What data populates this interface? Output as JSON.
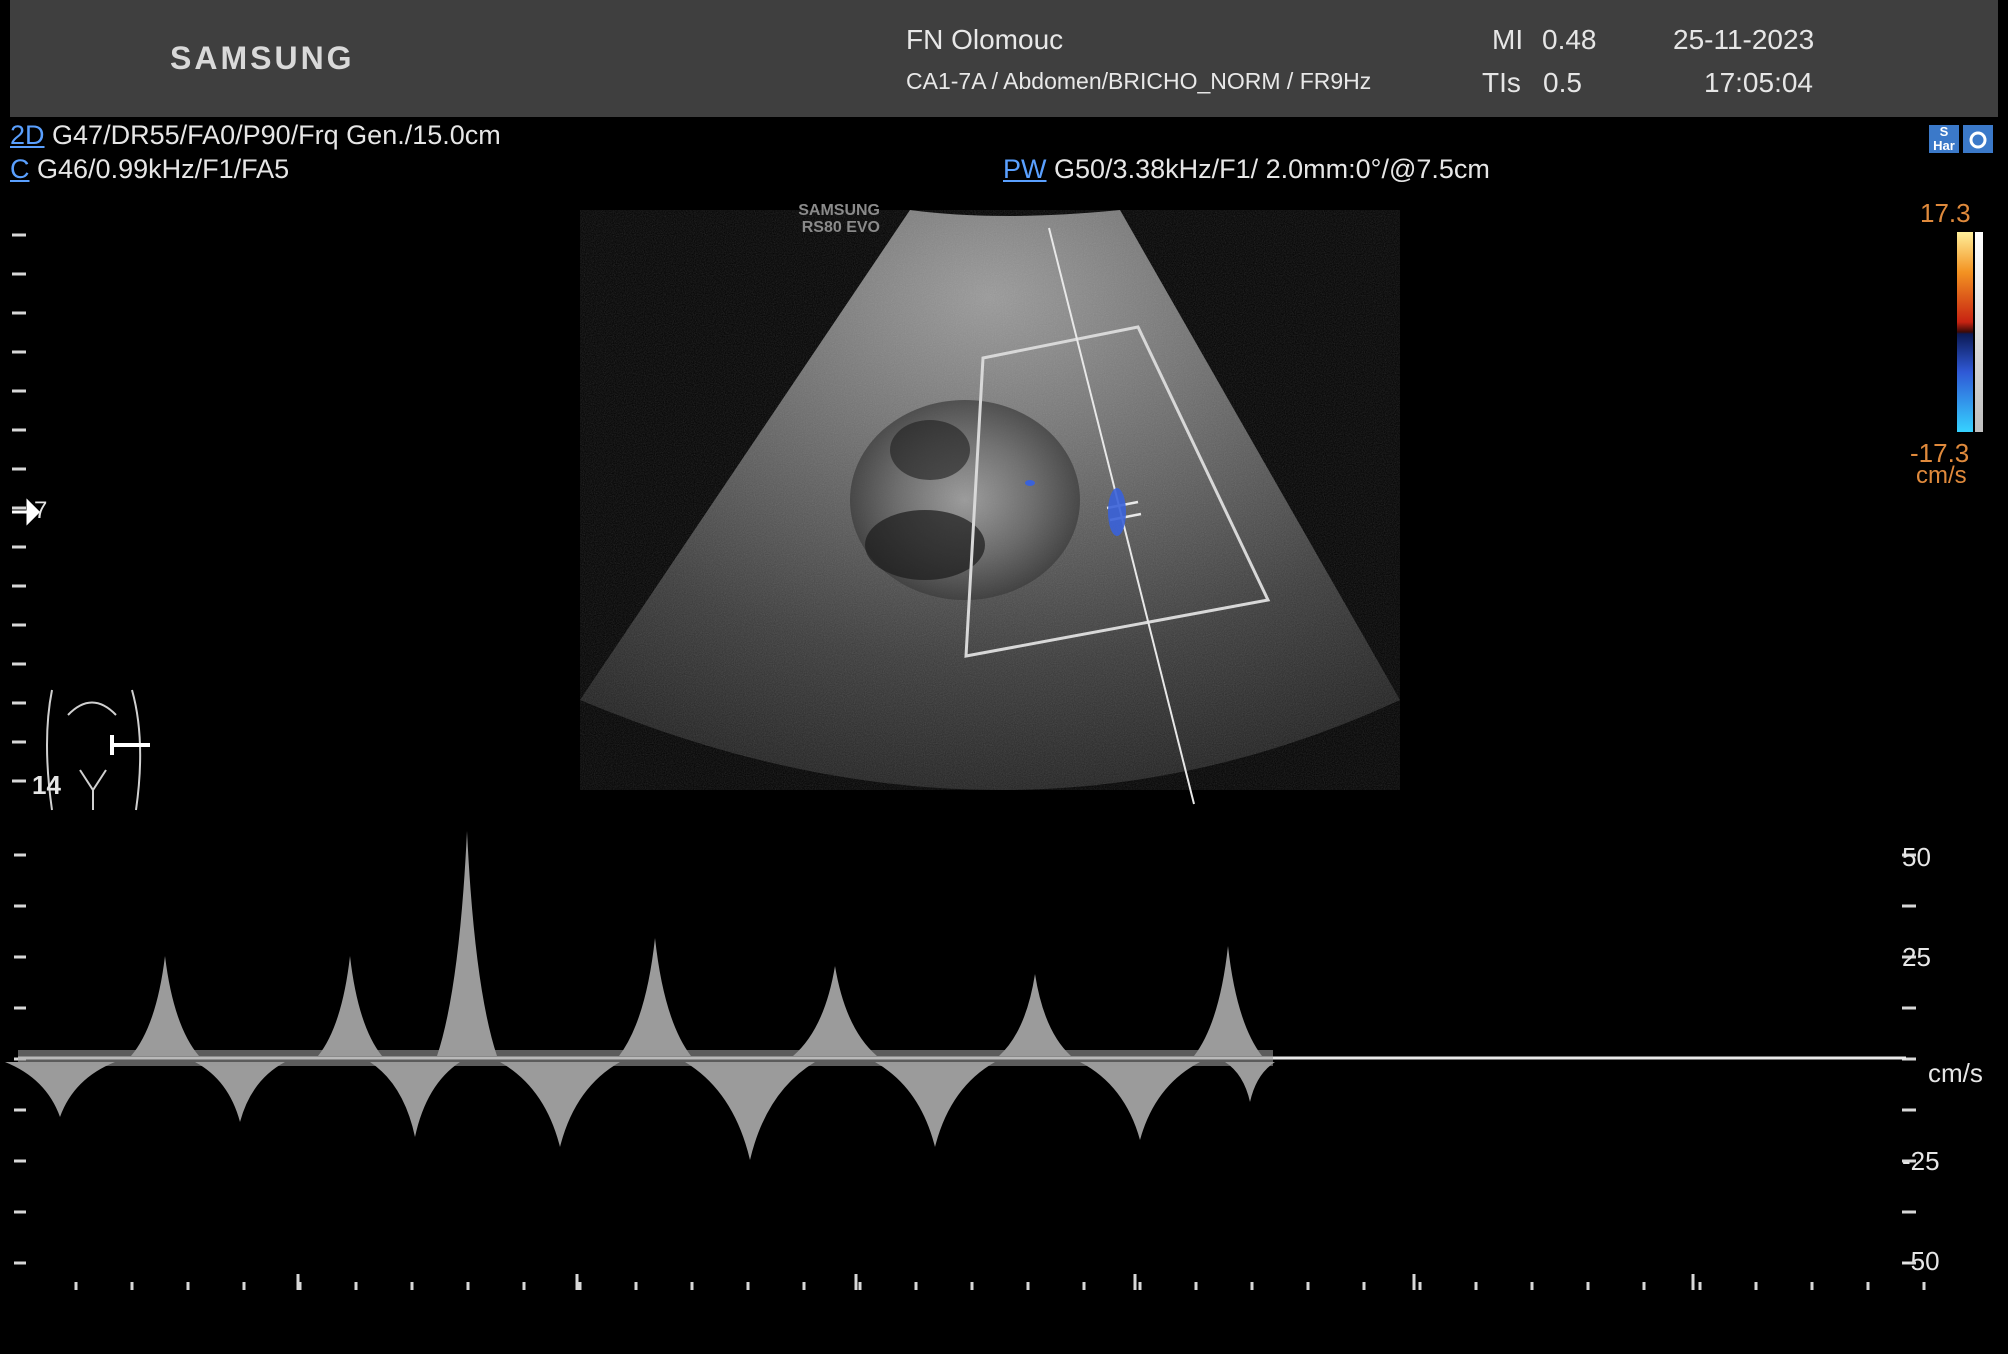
{
  "header": {
    "brand": "SAMSUNG",
    "institution": "FN Olomouc",
    "probe_preset": "CA1-7A / Abdomen/BRICHO_NORM / FR9Hz",
    "mi_label": "MI",
    "mi_value": "0.48",
    "tis_label": "TIs",
    "tis_value": "0.5",
    "date": "25-11-2023",
    "time": "17:05:04"
  },
  "params": {
    "mode_2d": "2D",
    "mode_2d_values": "G47/DR55/FA0/P90/Frq Gen./15.0cm",
    "mode_c": "C",
    "mode_c_values": "G46/0.99kHz/F1/FA5",
    "mode_pw": "PW",
    "mode_pw_values": "G50/3.38kHz/F1/ 2.0mm:0°/@7.5cm"
  },
  "device_label": {
    "line1": "SAMSUNG",
    "line2": "RS80 EVO"
  },
  "color_scale": {
    "top": "17.3",
    "bottom": "-17.3",
    "unit": "cm/s",
    "colors": [
      "#ffef9a",
      "#f39322",
      "#c72312",
      "#2f59d6",
      "#36d2ff"
    ]
  },
  "depth_markers": {
    "focus": "7",
    "depth": "14"
  },
  "spectral_scale": {
    "labels": [
      "50",
      "25",
      "cm/s",
      "-25",
      "-50"
    ],
    "v50": "50",
    "v25": "25",
    "unit": "cm/s",
    "vm25": "-25",
    "vm50": "-50"
  },
  "icons": {
    "header_icon_1": "S Har",
    "header_icon_2": "camera-icon"
  }
}
